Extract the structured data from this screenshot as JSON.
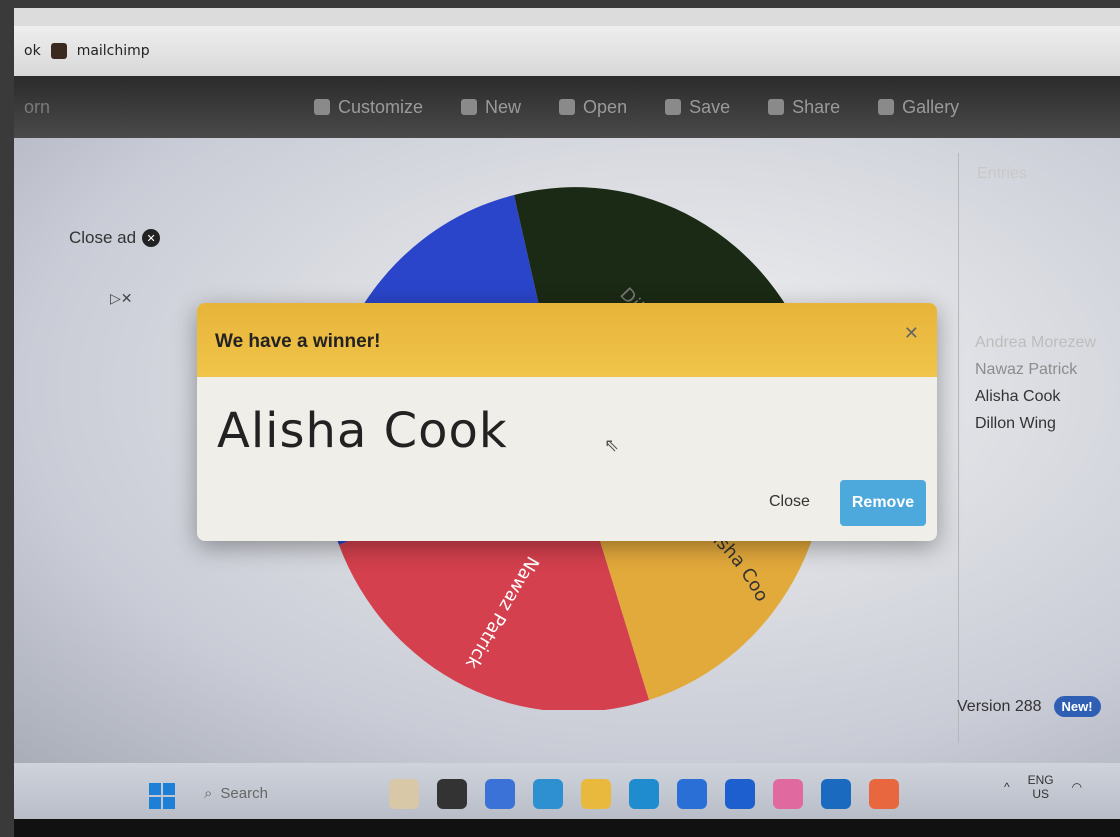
{
  "browser": {
    "tab_partial": "ok",
    "bookmark_label": "mailchimp"
  },
  "toolbar": {
    "left_partial": "orn",
    "items": [
      {
        "label": "Customize",
        "icon": "palette-icon"
      },
      {
        "label": "New",
        "icon": "file-icon"
      },
      {
        "label": "Open",
        "icon": "folder-icon"
      },
      {
        "label": "Save",
        "icon": "save-icon"
      },
      {
        "label": "Share",
        "icon": "share-icon"
      },
      {
        "label": "Gallery",
        "icon": "search-icon"
      }
    ]
  },
  "ad": {
    "close_label": "Close ad",
    "close_icon": "close-icon"
  },
  "wheel": {
    "segments": [
      {
        "label": "",
        "color": "#2a45c9"
      },
      {
        "label": "Dillon Wing",
        "color": "#1b2a14"
      },
      {
        "label": "Alisha Cook",
        "color": "#e2a93b"
      },
      {
        "label": "Nawaz Patrick",
        "color": "#d4404d"
      }
    ]
  },
  "entries": {
    "title": "Entries",
    "list": [
      "Andrea Morezew",
      "Nawaz Patrick",
      "Alisha Cook",
      "Dillon Wing"
    ]
  },
  "version": {
    "label": "Version 288",
    "badge": "New!"
  },
  "modal": {
    "title": "We have a winner!",
    "winner": "Alisha Cook",
    "close_label": "Close",
    "remove_label": "Remove",
    "header_color": "#f0c44a",
    "remove_color": "#4da8dc"
  },
  "taskbar": {
    "search_label": "Search",
    "lang_top": "ENG",
    "lang_bottom": "US"
  }
}
